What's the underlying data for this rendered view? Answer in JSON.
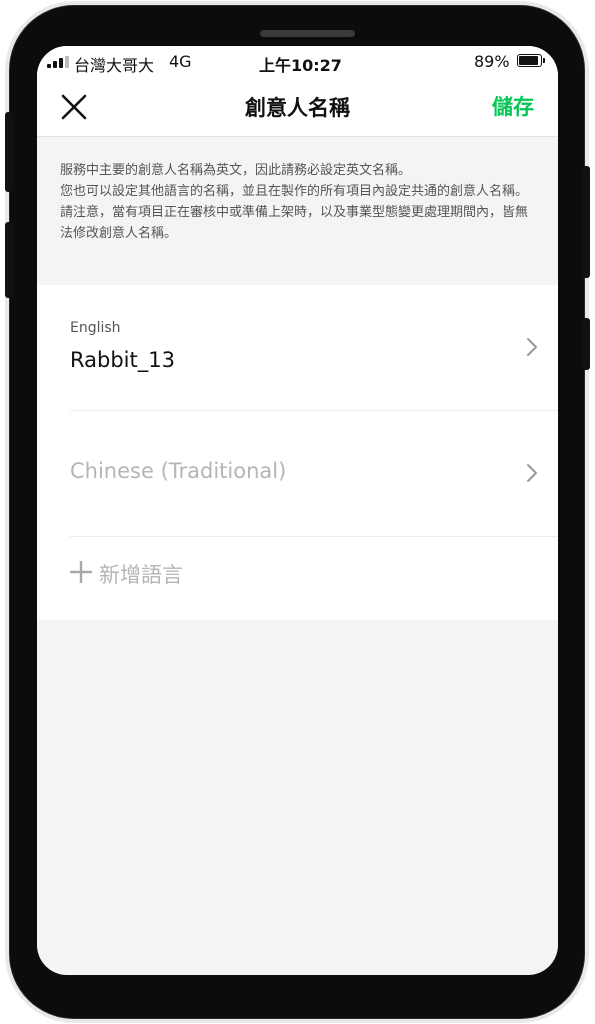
{
  "status_bar": {
    "carrier": "台灣大哥大",
    "network": "4G",
    "time": "上午10:27",
    "battery": "89%",
    "battery_level": 0.89
  },
  "nav": {
    "title": "創意人名稱",
    "save_label": "儲存",
    "close_icon": "close-icon",
    "accent_color": "#06c755"
  },
  "notice": {
    "text": "服務中主要的創意人名稱為英文，因此請務必設定英文名稱。\n您也可以設定其他語言的名稱，並且在製作的所有項目內設定共通的創意人名稱。\n請注意，當有項目正在審核中或準備上架時，以及事業型態變更處理期間內，皆無法修改創意人名稱。"
  },
  "languages": [
    {
      "label": "English",
      "value": "Rabbit_13"
    },
    {
      "label": "",
      "placeholder": "Chinese (Traditional)"
    }
  ],
  "add_language": {
    "label": "新增語言",
    "icon": "plus-icon"
  }
}
